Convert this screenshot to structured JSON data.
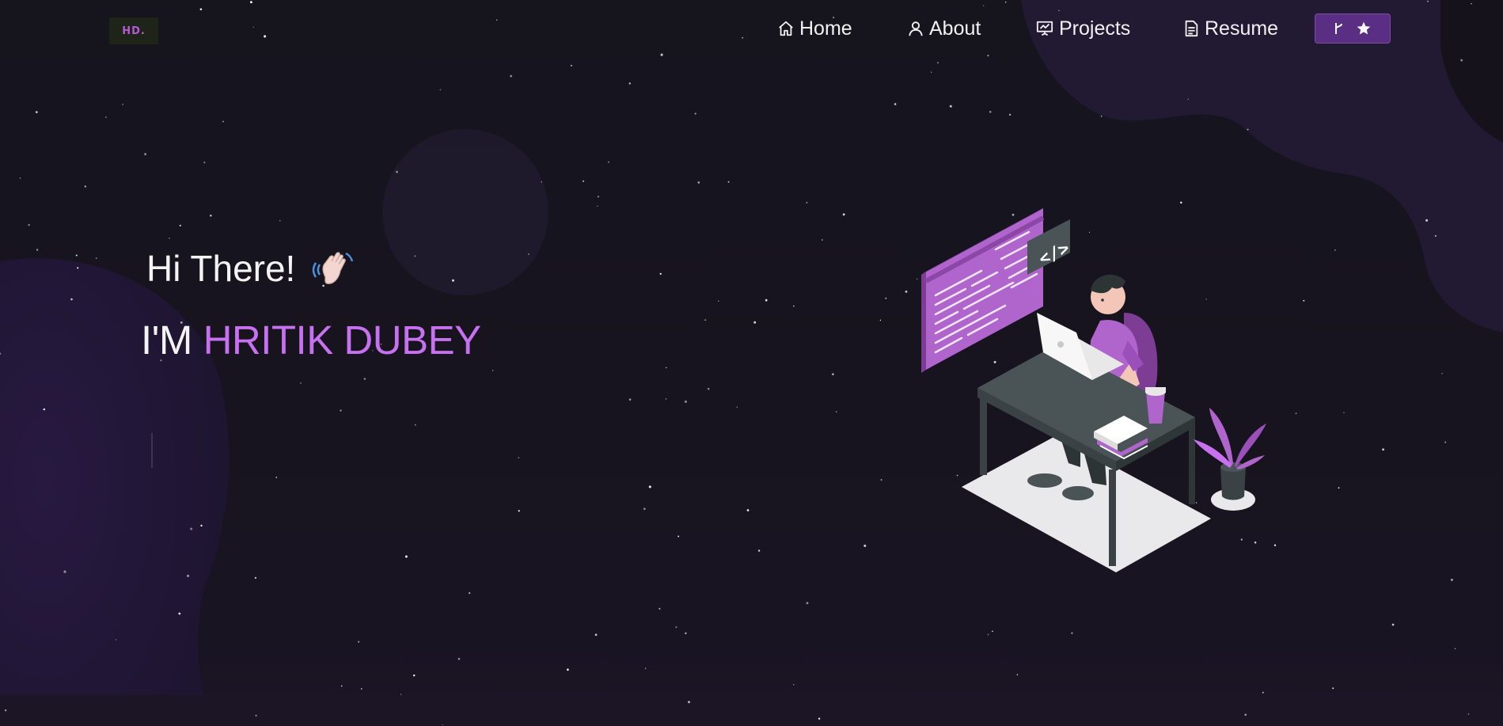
{
  "logo": {
    "text": "HD."
  },
  "nav": {
    "items": [
      {
        "label": "Home",
        "icon": "home-icon"
      },
      {
        "label": "About",
        "icon": "user-icon"
      },
      {
        "label": "Projects",
        "icon": "presentation-icon"
      },
      {
        "label": "Resume",
        "icon": "document-icon"
      }
    ],
    "github_button": {
      "icons": [
        "git-fork-icon",
        "star-icon"
      ]
    }
  },
  "hero": {
    "greeting": "Hi There!",
    "greeting_emoji": "waving-hand-icon",
    "intro_prefix": "I'M",
    "name": "HRITIK DUBEY",
    "illustration": "developer-at-desk-illustration"
  },
  "colors": {
    "background": "#16141d",
    "accent": "#c770f0",
    "button": "#5a2f83",
    "blob": "#2a1a45"
  }
}
